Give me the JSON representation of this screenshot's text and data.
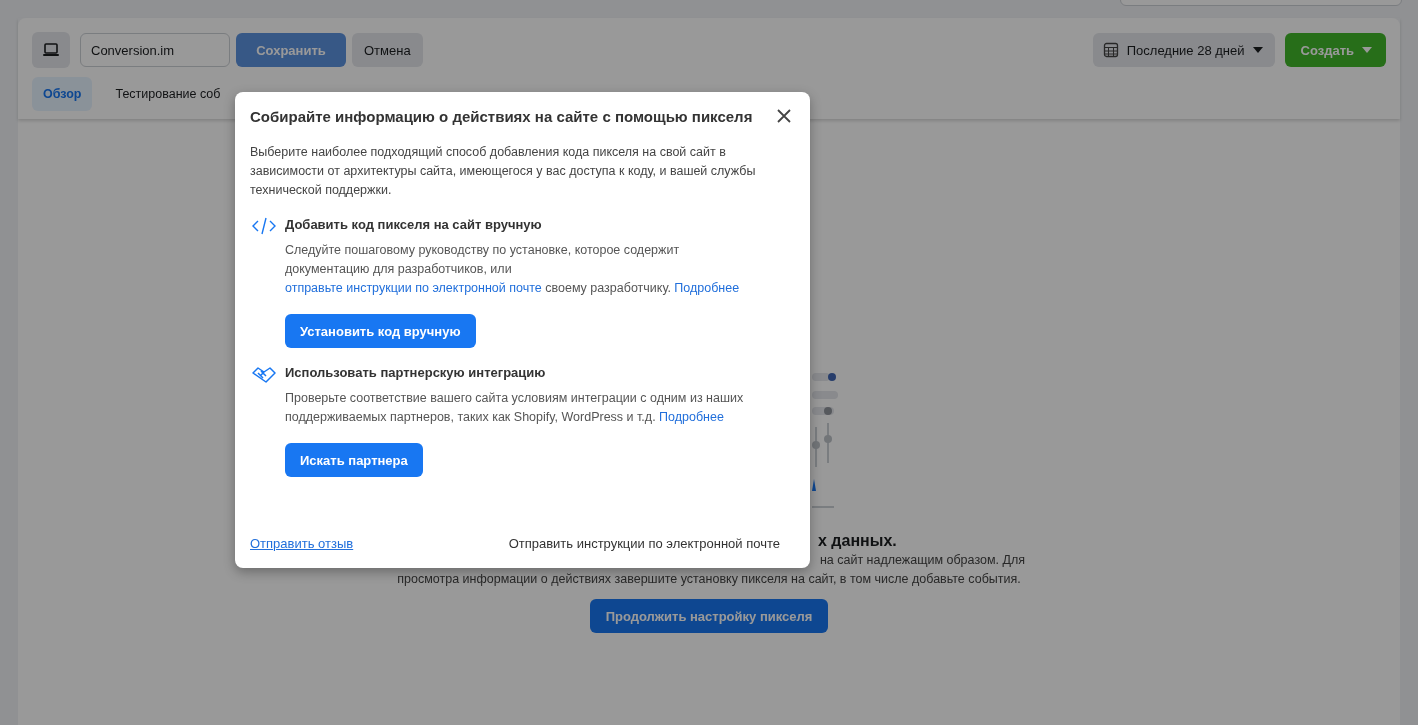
{
  "toolbar": {
    "pixel_name": "Conversion.im",
    "save_button": {
      "label": "Сохранить",
      "disabled": true
    },
    "cancel_button": "Отмена",
    "date_range": "Последние 28 дней",
    "create_button": "Создать"
  },
  "tabs": [
    {
      "label": "Обзор",
      "selected": true
    },
    {
      "label": "Тестирование соб",
      "selected": false
    }
  ],
  "empty_state": {
    "title": "х данных.",
    "line_1": "на сайт надлежащим образом. Для",
    "line_2": "просмотра информации о действиях завершите установку пикселя на сайт, в том числе добавьте события.",
    "button": "Продолжить настройку пикселя"
  },
  "modal": {
    "title": "Собирайте информацию о действиях на сайте с помощью пикселя",
    "intro": "Выберите наиболее подходящий способ добавления кода пикселя на свой сайт в зависимости от архитектуры сайта, имеющегося у вас доступа к коду, и вашей службы технической поддержки.",
    "options": [
      {
        "kind": "code",
        "title": "Добавить код пикселя на сайт вручную",
        "description": [
          {
            "kind": "text",
            "text": "Следуйте пошаговому руководству по установке, которое содержит документацию для разработчиков, или "
          },
          {
            "kind": "link",
            "text": "отправьте инструкции по электронной почте"
          },
          {
            "kind": "text",
            "text": " своему разработчику. "
          },
          {
            "kind": "link",
            "text": "Подробнее"
          }
        ],
        "button": "Установить код вручную"
      },
      {
        "kind": "partner",
        "title": "Использовать партнерскую интеграцию",
        "description": [
          {
            "kind": "text",
            "text": "Проверьте соответствие вашего сайта условиям интеграции с одним из наших поддерживаемых партнеров, таких как Shopify, WordPress и т.д. "
          },
          {
            "kind": "link",
            "text": "Подробнее"
          }
        ],
        "button": "Искать партнера"
      }
    ],
    "feedback_link": "Отправить отзыв",
    "email_button": "Отправить инструкции по электронной почте"
  }
}
